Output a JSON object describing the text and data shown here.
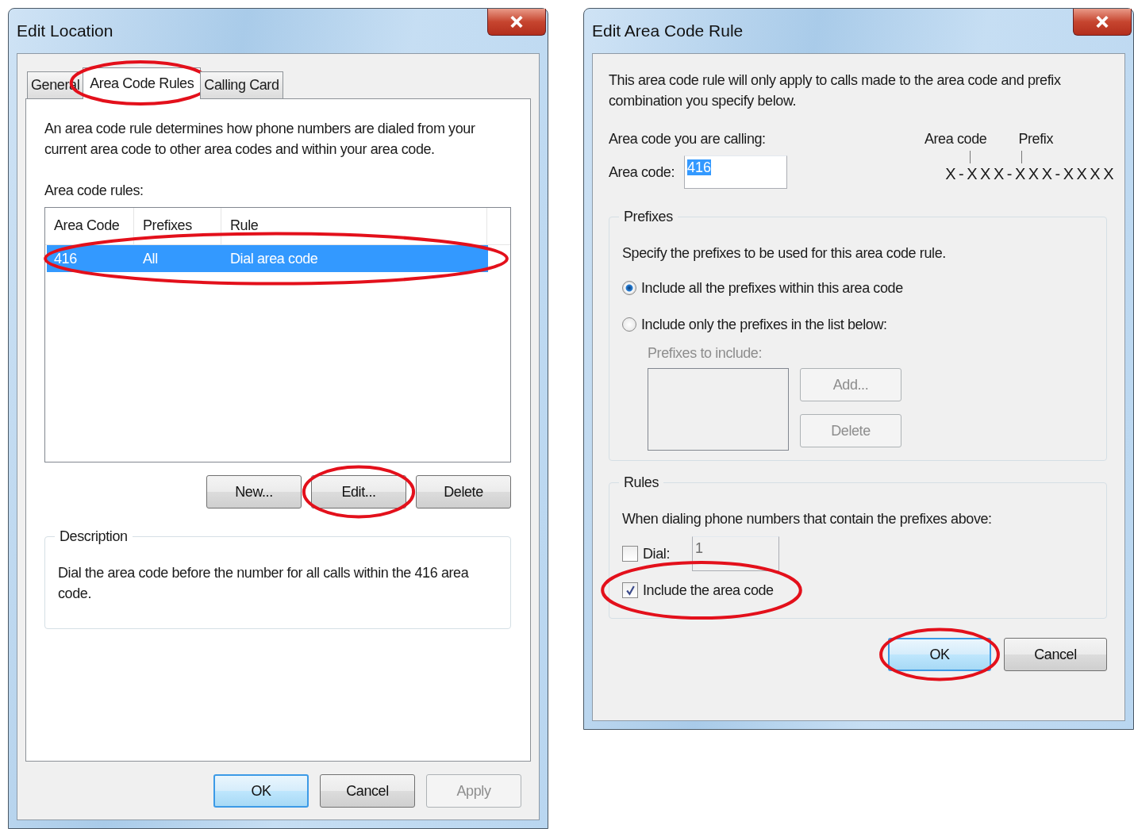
{
  "edit_location": {
    "title": "Edit Location",
    "tabs": [
      {
        "label": "General",
        "selected": false,
        "circled": false
      },
      {
        "label": "Area Code Rules",
        "selected": true,
        "circled": true
      },
      {
        "label": "Calling Card",
        "selected": false,
        "circled": false
      }
    ],
    "intro": "An area code rule determines how phone numbers are dialed from your current area code to other area codes and within your area code.",
    "rules_label": "Area code rules:",
    "table": {
      "columns": [
        "Area Code",
        "Prefixes",
        "Rule"
      ],
      "rows": [
        {
          "cells": [
            "416",
            "All",
            "Dial area code"
          ],
          "selected": true,
          "circled": true
        }
      ]
    },
    "buttons": [
      {
        "label": "New...",
        "circled": false
      },
      {
        "label": "Edit...",
        "circled": true
      },
      {
        "label": "Delete",
        "circled": false
      }
    ],
    "description": {
      "title": "Description",
      "text": "Dial the area code before the number for all calls within the 416 area code."
    },
    "footer_buttons": [
      {
        "label": "OK",
        "default": true,
        "disabled": false,
        "circled": false
      },
      {
        "label": "Cancel",
        "default": false,
        "disabled": false,
        "circled": false
      },
      {
        "label": "Apply",
        "default": false,
        "disabled": true,
        "circled": false
      }
    ]
  },
  "edit_area_code_rule": {
    "title": "Edit Area Code Rule",
    "intro": "This area code rule will only apply to calls made to the area code and prefix combination you specify below.",
    "calling_label": "Area code you are calling:",
    "area_code": {
      "label": "Area code:",
      "value": "416"
    },
    "diagram": {
      "area_code_label": "Area code",
      "prefix_label": "Prefix",
      "pattern": "X-XXX-XXX-XXXX"
    },
    "prefixes": {
      "title": "Prefixes",
      "text": "Specify the prefixes to be used for this area code rule.",
      "options": [
        {
          "label": "Include all the prefixes within this area code",
          "selected": true
        },
        {
          "label": "Include only the prefixes in the list below:",
          "selected": false
        }
      ],
      "list_label": "Prefixes to include:",
      "buttons": [
        {
          "label": "Add...",
          "disabled": true
        },
        {
          "label": "Delete",
          "disabled": true
        }
      ]
    },
    "rules": {
      "title": "Rules",
      "text": "When dialing phone numbers that contain the prefixes above:",
      "dial": {
        "label": "Dial:",
        "checked": false,
        "value": "1"
      },
      "include": {
        "label": "Include the area code",
        "checked": true,
        "circled": true
      }
    },
    "footer_buttons": [
      {
        "label": "OK",
        "default": true,
        "disabled": false,
        "circled": true
      },
      {
        "label": "Cancel",
        "default": false,
        "disabled": false,
        "circled": false
      }
    ]
  }
}
